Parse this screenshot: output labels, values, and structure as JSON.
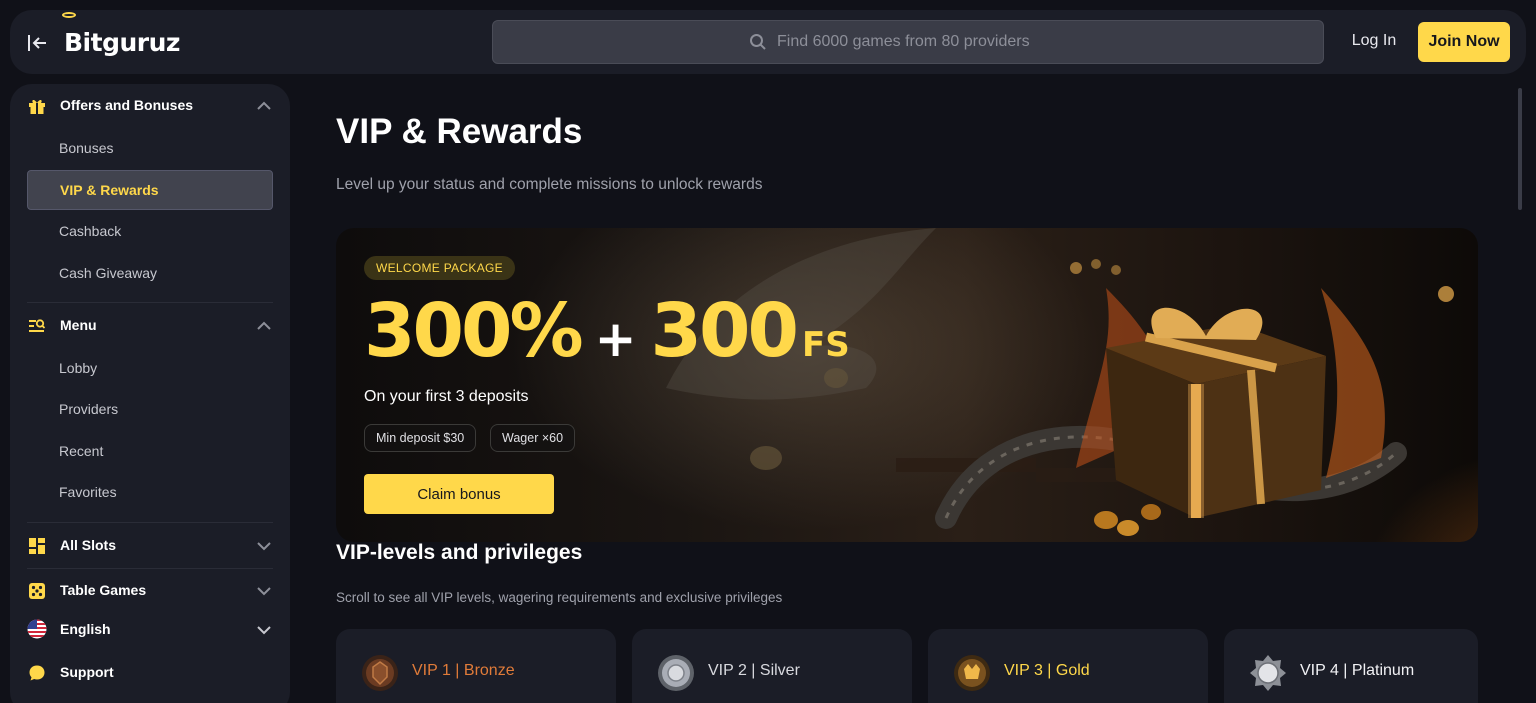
{
  "header": {
    "logo_text": "Bitguruz",
    "search_placeholder": "Find 6000 games from 80 providers",
    "login_label": "Log In",
    "join_label": "Join Now"
  },
  "sidebar": {
    "offers": {
      "title": "Offers and Bonuses",
      "items": [
        "Bonuses",
        "VIP & Rewards",
        "Cashback",
        "Cash Giveaway"
      ],
      "active": "VIP & Rewards"
    },
    "menu": {
      "title": "Menu",
      "items": [
        "Lobby",
        "Providers",
        "Recent",
        "Favorites"
      ]
    },
    "all_slots": "All Slots",
    "table_games": "Table Games",
    "language": "English",
    "support": "Support"
  },
  "main": {
    "title": "VIP & Rewards",
    "subtitle": "Level up your status and complete missions to unlock rewards",
    "banner": {
      "badge": "WELCOME PACKAGE",
      "percent": "300%",
      "plus": "+",
      "spins": "300",
      "fs": "FS",
      "description": "On your first 3 deposits",
      "chips": [
        "Min deposit $30",
        "Wager ×60"
      ],
      "cta": "Claim bonus"
    },
    "vip_section": {
      "title": "VIP-levels and privileges",
      "subtitle": "Scroll to see all VIP levels, wagering requirements and exclusive privileges",
      "levels": [
        {
          "label": "VIP 1 | Bronze",
          "color": "#e07b39"
        },
        {
          "label": "VIP 2 | Silver",
          "color": "#d8d9de"
        },
        {
          "label": "VIP 3 | Gold",
          "color": "#ffd84a"
        },
        {
          "label": "VIP 4 | Platinum",
          "color": "#f1f1f4"
        }
      ]
    }
  },
  "colors": {
    "accent": "#ffd84a",
    "panel": "#1b1d27",
    "background": "#101118"
  }
}
